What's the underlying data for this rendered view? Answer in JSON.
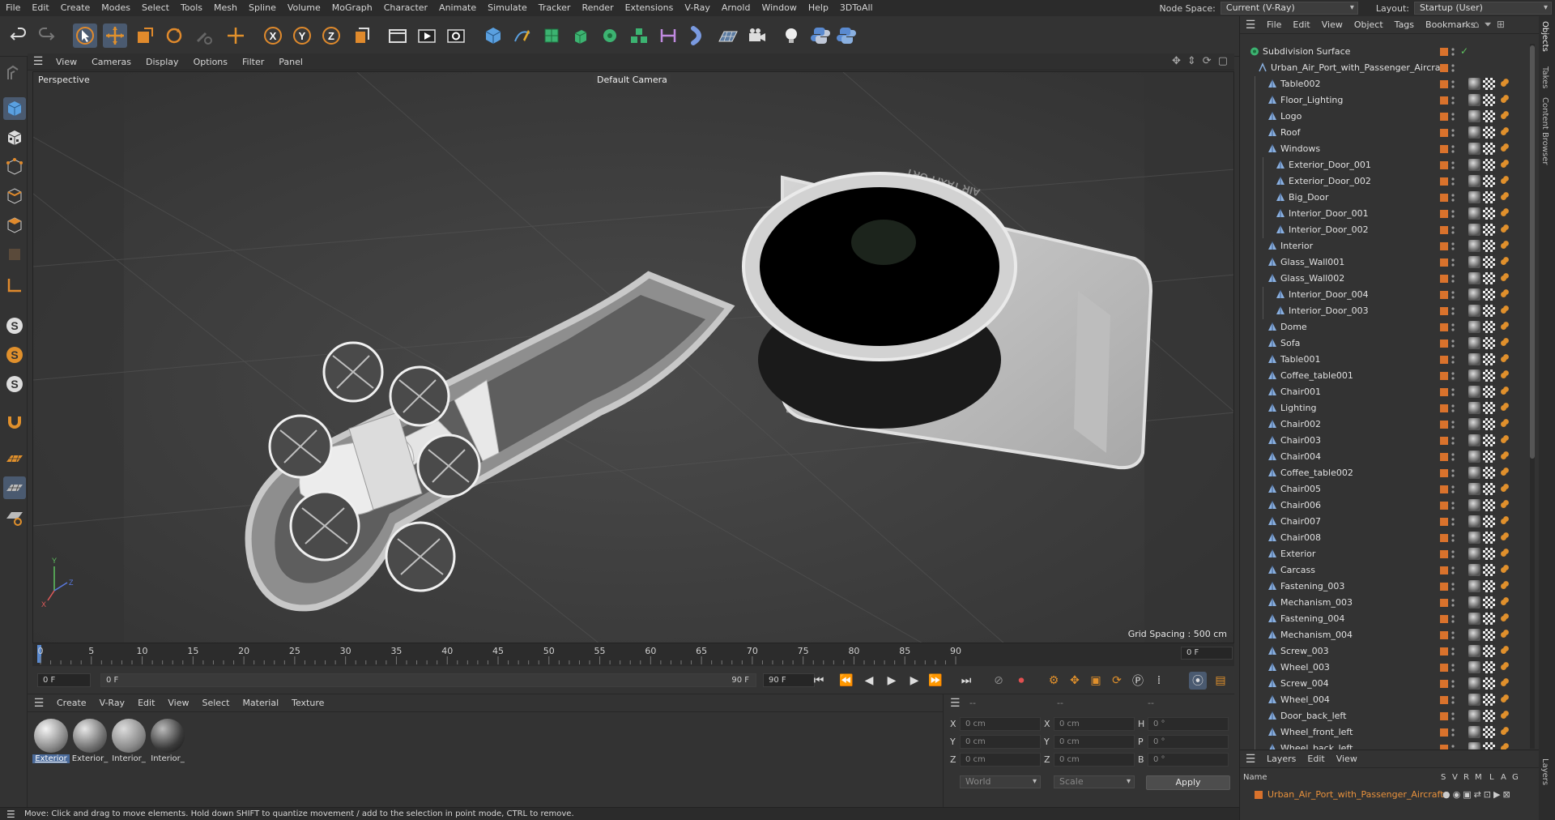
{
  "menubar": {
    "items": [
      "File",
      "Edit",
      "Create",
      "Modes",
      "Select",
      "Tools",
      "Mesh",
      "Spline",
      "Volume",
      "MoGraph",
      "Character",
      "Animate",
      "Simulate",
      "Tracker",
      "Render",
      "Extensions",
      "V-Ray",
      "Arnold",
      "Window",
      "Help",
      "3DToAll"
    ],
    "node_space_label": "Node Space:",
    "node_space_value": "Current (V-Ray)",
    "layout_label": "Layout:",
    "layout_value": "Startup (User)"
  },
  "toolbar": {
    "icons": [
      "undo-icon",
      "redo-icon",
      "select-arrow-icon",
      "move-icon",
      "scale-icon",
      "rotate-icon",
      "recent-tool-icon",
      "transform-icon",
      "x-axis-lock-icon",
      "y-axis-lock-icon",
      "z-axis-lock-icon",
      "coordinate-system-icon",
      "render-region-icon",
      "render-view-icon",
      "render-settings-icon",
      "cube-primitive-icon",
      "pen-spline-icon",
      "subdivision-icon",
      "extrude-icon",
      "cloner-icon",
      "array-icon",
      "deformer-icon",
      "bend-icon",
      "floor-icon",
      "camera-icon",
      "light-icon",
      "python-icon",
      "python-alt-icon"
    ],
    "axis_x": "X",
    "axis_y": "Y",
    "axis_z": "Z"
  },
  "left_tools": [
    "model-mode-icon",
    "mesh-edit-icon",
    "texture-mode-icon",
    "points-mode-icon",
    "edges-mode-icon",
    "polygons-mode-icon",
    "uvw-mode-icon",
    "axis-mode-icon",
    "snap-icon",
    "snap-settings-icon",
    "quantize-icon",
    "magnet-icon",
    "workplane-icon",
    "grid-lock-icon",
    "locked-workplane-icon"
  ],
  "viewport": {
    "menu": [
      "View",
      "Cameras",
      "Display",
      "Options",
      "Filter",
      "Panel"
    ],
    "view_name": "Perspective",
    "camera_name": "Default Camera",
    "grid_spacing": "Grid Spacing : 500 cm",
    "sign_text": "AIR TAXI PORT"
  },
  "timeline": {
    "ticks": [
      "0",
      "5",
      "10",
      "15",
      "20",
      "25",
      "30",
      "35",
      "40",
      "45",
      "50",
      "55",
      "60",
      "65",
      "70",
      "75",
      "80",
      "85",
      "90"
    ],
    "current_frame": "0 F"
  },
  "transport": {
    "start_field": "0 F",
    "range_start": "0 F",
    "range_end": "90 F",
    "end_field": "90 F"
  },
  "materials": {
    "menu": [
      "Create",
      "V-Ray",
      "Edit",
      "View",
      "Select",
      "Material",
      "Texture"
    ],
    "items": [
      "Exterior",
      "Exterior_",
      "Interior_",
      "Interior_"
    ]
  },
  "coords": {
    "headers": [
      "--",
      "--",
      "--"
    ],
    "rows": [
      {
        "a": "X",
        "av": "0 cm",
        "b": "X",
        "bv": "0 cm",
        "c": "H",
        "cv": "0 °"
      },
      {
        "a": "Y",
        "av": "0 cm",
        "b": "Y",
        "bv": "0 cm",
        "c": "P",
        "cv": "0 °"
      },
      {
        "a": "Z",
        "av": "0 cm",
        "b": "Z",
        "bv": "0 cm",
        "c": "B",
        "cv": "0 °"
      }
    ],
    "space": "World",
    "mode": "Scale",
    "apply": "Apply"
  },
  "status": "Move: Click and drag to move elements. Hold down SHIFT to quantize movement / add to the selection in point mode, CTRL to remove.",
  "object_manager": {
    "menu": [
      "File",
      "Edit",
      "View",
      "Object",
      "Tags",
      "Bookmarks"
    ],
    "objects": [
      {
        "name": "Subdivision Surface",
        "depth": 0
      },
      {
        "name": "Urban_Air_Port_with_Passenger_Aircraft",
        "depth": 1
      },
      {
        "name": "Table002",
        "depth": 2
      },
      {
        "name": "Floor_Lighting",
        "depth": 2
      },
      {
        "name": "Logo",
        "depth": 2
      },
      {
        "name": "Roof",
        "depth": 2
      },
      {
        "name": "Windows",
        "depth": 2
      },
      {
        "name": "Exterior_Door_001",
        "depth": 3
      },
      {
        "name": "Exterior_Door_002",
        "depth": 3
      },
      {
        "name": "Big_Door",
        "depth": 3
      },
      {
        "name": "Interior_Door_001",
        "depth": 3
      },
      {
        "name": "Interior_Door_002",
        "depth": 3
      },
      {
        "name": "Interior",
        "depth": 2
      },
      {
        "name": "Glass_Wall001",
        "depth": 2
      },
      {
        "name": "Glass_Wall002",
        "depth": 2
      },
      {
        "name": "Interior_Door_004",
        "depth": 3
      },
      {
        "name": "Interior_Door_003",
        "depth": 3
      },
      {
        "name": "Dome",
        "depth": 2
      },
      {
        "name": "Sofa",
        "depth": 2
      },
      {
        "name": "Table001",
        "depth": 2
      },
      {
        "name": "Coffee_table001",
        "depth": 2
      },
      {
        "name": "Chair001",
        "depth": 2
      },
      {
        "name": "Lighting",
        "depth": 2
      },
      {
        "name": "Chair002",
        "depth": 2
      },
      {
        "name": "Chair003",
        "depth": 2
      },
      {
        "name": "Chair004",
        "depth": 2
      },
      {
        "name": "Coffee_table002",
        "depth": 2
      },
      {
        "name": "Chair005",
        "depth": 2
      },
      {
        "name": "Chair006",
        "depth": 2
      },
      {
        "name": "Chair007",
        "depth": 2
      },
      {
        "name": "Chair008",
        "depth": 2
      },
      {
        "name": "Exterior",
        "depth": 2
      },
      {
        "name": "Carcass",
        "depth": 2
      },
      {
        "name": "Fastening_003",
        "depth": 2
      },
      {
        "name": "Mechanism_003",
        "depth": 2
      },
      {
        "name": "Fastening_004",
        "depth": 2
      },
      {
        "name": "Mechanism_004",
        "depth": 2
      },
      {
        "name": "Screw_003",
        "depth": 2
      },
      {
        "name": "Wheel_003",
        "depth": 2
      },
      {
        "name": "Screw_004",
        "depth": 2
      },
      {
        "name": "Wheel_004",
        "depth": 2
      },
      {
        "name": "Door_back_left",
        "depth": 2
      },
      {
        "name": "Wheel_front_left",
        "depth": 2
      },
      {
        "name": "Wheel_back_left",
        "depth": 2
      }
    ]
  },
  "layers": {
    "menu": [
      "Layers",
      "Edit",
      "View"
    ],
    "header_name": "Name",
    "header_cols": [
      "S",
      "V",
      "R",
      "M",
      "L",
      "A",
      "G"
    ],
    "layer_name": "Urban_Air_Port_with_Passenger_Aircraft"
  },
  "right_tabs": [
    "Objects",
    "Takes",
    "Content Browser",
    "Layers"
  ],
  "colors": {
    "accent_orange": "#d9722c",
    "selection_blue": "#4a5a70",
    "viewport_bg": "#3a3a3a"
  }
}
